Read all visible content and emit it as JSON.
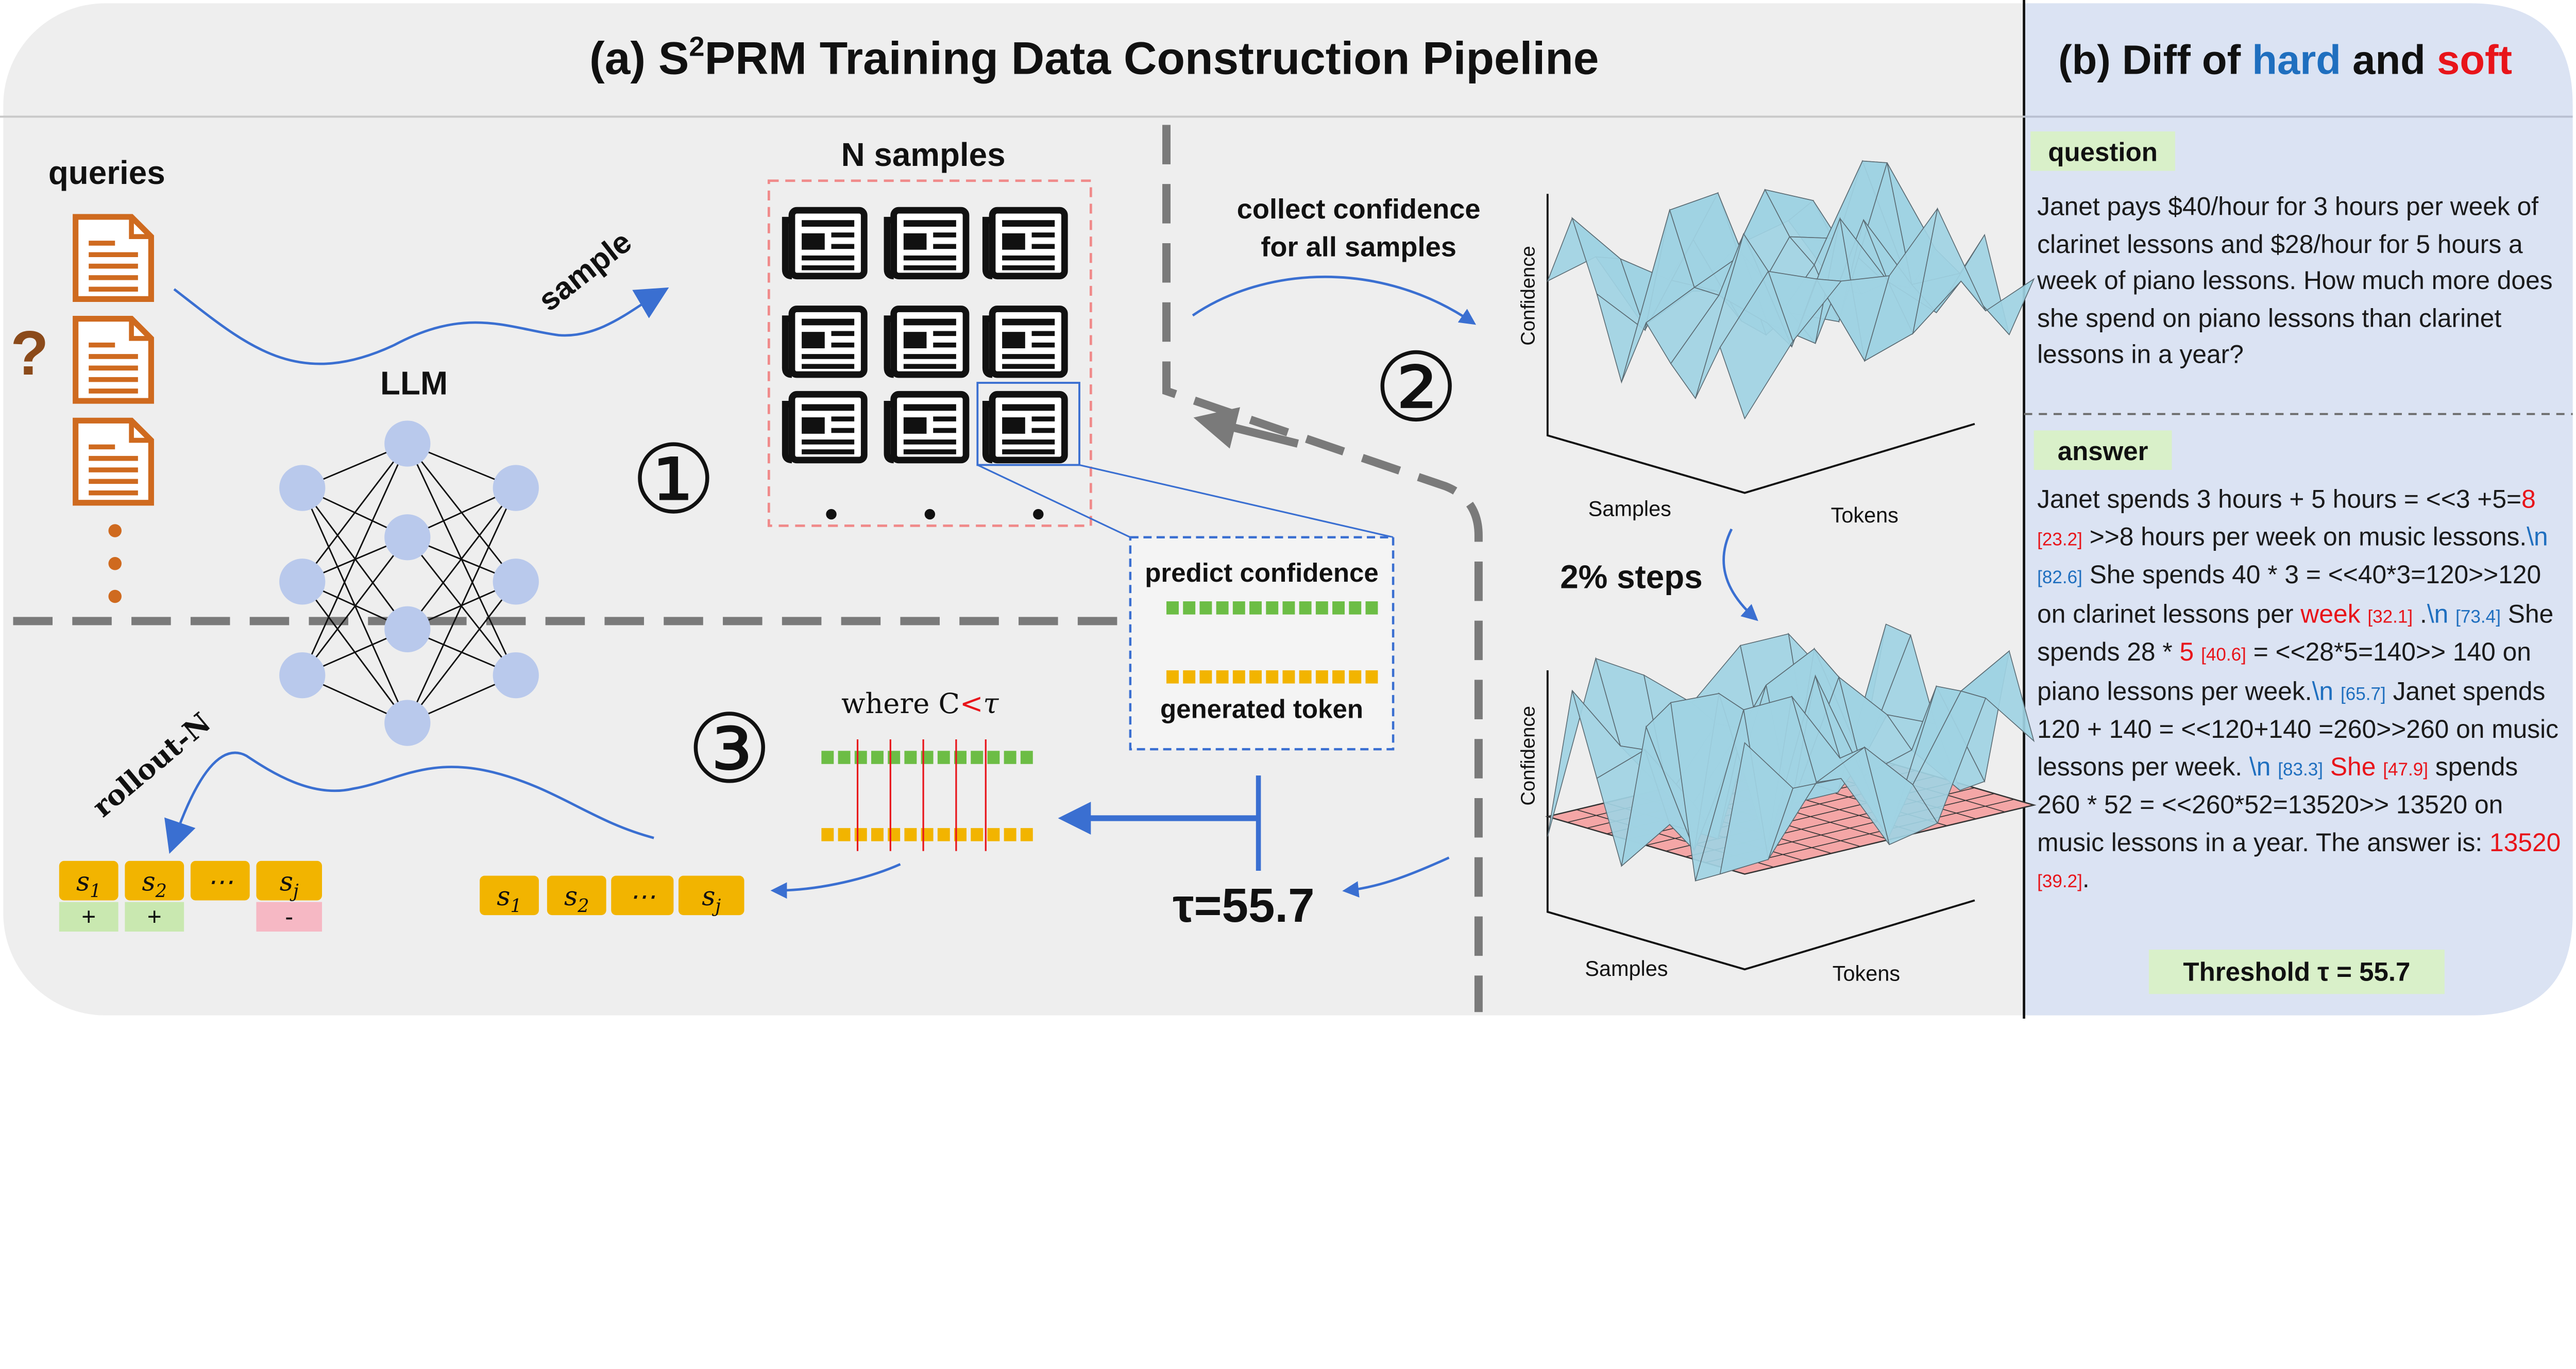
{
  "panel_a": {
    "title_prefix": "(a) S",
    "title_sup": "2",
    "title_suffix": "PRM Training Data Construction Pipeline",
    "queries_label": "queries",
    "question_mark": "?",
    "llm_label": "LLM",
    "sample_label": "sample",
    "n_samples_label": "N samples",
    "step1": "①",
    "step2": "②",
    "step3": "③",
    "collect_line1": "collect confidence",
    "collect_line2": "for all samples",
    "predict_confidence": "predict confidence",
    "generated_token": "generated token",
    "where_prefix": "where C",
    "where_lt": "<",
    "where_tau": "τ",
    "tau_value": "τ=55.7",
    "steps_label": "2% steps",
    "chart_top": {
      "ylabel": "Confidence",
      "xlabel_left": "Samples",
      "xlabel_right": "Tokens"
    },
    "chart_bottom": {
      "ylabel": "Confidence",
      "xlabel_left": "Samples",
      "xlabel_right": "Tokens"
    },
    "rollout_label": "rollout-N",
    "steps_row": [
      "s",
      "s",
      "⋯",
      "s"
    ],
    "steps_sub": [
      "1",
      "2",
      "",
      "j"
    ],
    "step_signs": [
      "+",
      "+",
      "-"
    ],
    "colors": {
      "orange_doc": "#cf6a1f",
      "node": "#b9c9ec",
      "gold": "#f2b400",
      "green": "#6cbd45",
      "blue_arrow": "#3a6fd1",
      "grey_dash": "#7a7a7a",
      "pink_box": "#f08a8a",
      "surface": "#9fd3e3",
      "panel_b_bg": "#dbe3f3"
    }
  },
  "panel_b": {
    "title_prefix": "(b) Diff of ",
    "title_hard": "hard",
    "title_and": " and ",
    "title_soft": "soft",
    "question_tag": "question",
    "question_text": "Janet pays $40/hour for 3 hours per week of clarinet lessons and $28/hour for 5 hours a week of piano lessons. How much more does she spend on piano lessons than clarinet lessons in a year?",
    "answer_tag": "answer",
    "answer": {
      "p1": "Janet spends 3 hours + 5 hours = <<3 +5=",
      "r1": "8",
      "c1": "[23.2]",
      "p2": " >>8 hours per week on music lessons.",
      "n1": "\\n",
      "c2": "[82.6]",
      "p3": " She spends 40 * 3 = <<40*3=120>>120 on clarinet lessons per ",
      "r2": "week",
      "c3": "[32.1]",
      "p4": " .",
      "n2": "\\n",
      "c4": "[73.4]",
      "p5": " She spends 28 * ",
      "r3": "5",
      "c5": "[40.6]",
      "p6": " = <<28*5=140>> 140 on piano lessons per week.",
      "n3": "\\n",
      "c6": "[65.7]",
      "p7": " Janet spends 120 + 140 = <<120+140 =260>>260 on music lessons per week. ",
      "n4": "\\n",
      "c7": "[83.3]",
      "r4": " She",
      "c8": "[47.9]",
      "p8": " spends 260 * 52 = <<260*52=13520>> 13520 on music lessons in a year. The answer is: ",
      "r5": "13520",
      "c9": "[39.2]",
      "p9": "."
    },
    "threshold": "Threshold τ = 55.7"
  }
}
